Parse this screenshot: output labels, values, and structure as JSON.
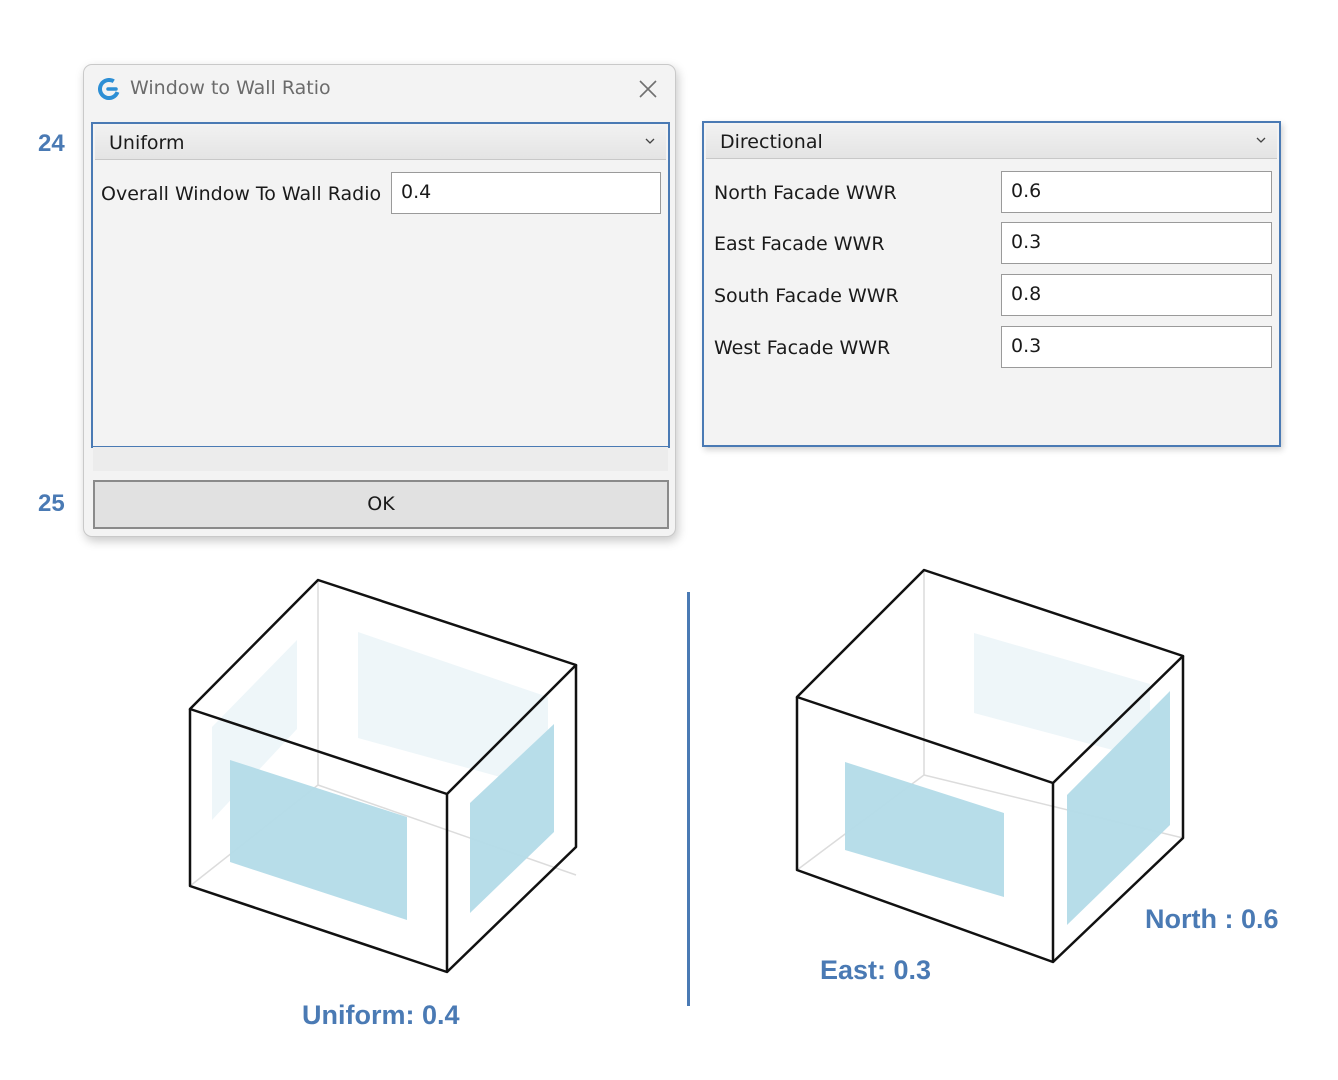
{
  "callouts": {
    "first": "24",
    "second": "25"
  },
  "dialog": {
    "title": "Window to Wall Ratio",
    "mode_selected": "Uniform",
    "overall_label": "Overall Window To Wall Radio",
    "overall_value": "0.4",
    "ok_label": "OK"
  },
  "directional_panel": {
    "mode_selected": "Directional",
    "fields": [
      {
        "label": "North Facade WWR",
        "value": "0.6"
      },
      {
        "label": "East Facade WWR",
        "value": "0.3"
      },
      {
        "label": "South Facade WWR",
        "value": "0.8"
      },
      {
        "label": "West Facade WWR",
        "value": "0.3"
      }
    ]
  },
  "illustrations": {
    "uniform_caption": "Uniform: 0.4",
    "east_caption": "East: 0.3",
    "north_caption": "North : 0.6"
  },
  "colors": {
    "accent": "#4a7ab4",
    "glazing": "#b3dbe8"
  }
}
